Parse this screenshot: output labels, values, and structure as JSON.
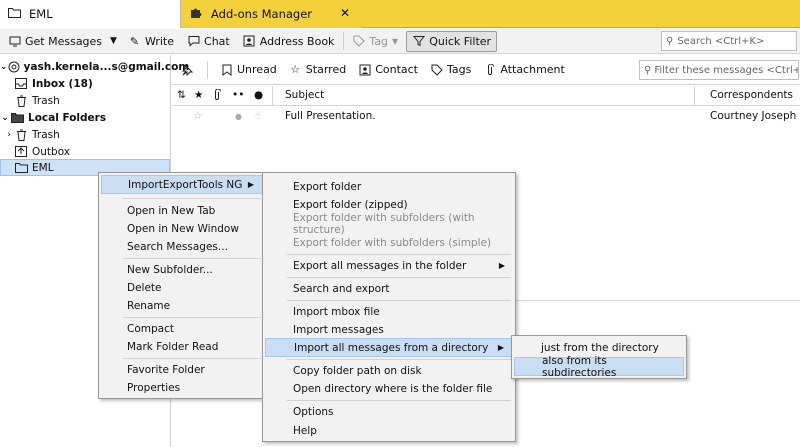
{
  "tabs": [
    {
      "label": "EML",
      "icon": "folder-icon"
    },
    {
      "label": "Add-ons Manager",
      "icon": "puzzle-icon",
      "close": "✕"
    }
  ],
  "toolbar": {
    "get_messages": "Get Messages",
    "write": "Write",
    "chat": "Chat",
    "address_book": "Address Book",
    "tag": "Tag",
    "quick_filter": "Quick Filter",
    "search_placeholder": "Search <Ctrl+K>"
  },
  "folders": {
    "account": "yash.kernela...s@gmail.com",
    "inbox": "Inbox (18)",
    "trash": "Trash",
    "local": "Local Folders",
    "local_trash": "Trash",
    "outbox": "Outbox",
    "eml": "EML"
  },
  "quickfilter": {
    "unread": "Unread",
    "starred": "Starred",
    "contact": "Contact",
    "tags": "Tags",
    "attachment": "Attachment",
    "placeholder": "Filter these messages <Ctrl+Shift+K>"
  },
  "thread": {
    "col_subject": "Subject",
    "col_correspondents": "Correspondents",
    "rows": [
      {
        "subject": "Full Presentation.",
        "correspondent": "Courtney Joseph"
      }
    ]
  },
  "menu1": [
    "ImportExportTools NG",
    "Open in New Tab",
    "Open in New Window",
    "Search Messages...",
    "New Subfolder...",
    "Delete",
    "Rename",
    "Compact",
    "Mark Folder Read",
    "Favorite Folder",
    "Properties"
  ],
  "menu2": [
    "Export folder",
    "Export folder (zipped)",
    "Export folder with subfolders (with structure)",
    "Export folder with subfolders (simple)",
    "Export all messages in the folder",
    "Search and export",
    "Import mbox file",
    "Import messages",
    "Import all messages from a directory",
    "Copy folder path on disk",
    "Open directory where is the folder file",
    "Options",
    "Help"
  ],
  "menu3": [
    "just from the directory",
    "also from its subdirectories"
  ],
  "colors": {
    "tab_accent": "#f4d13b",
    "highlight": "#c9ddf3"
  }
}
